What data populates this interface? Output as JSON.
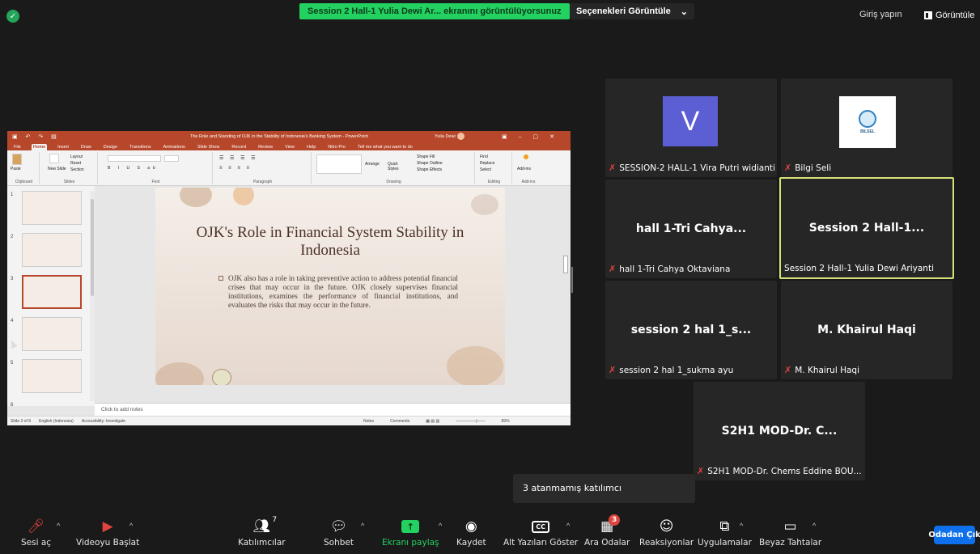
{
  "top": {
    "share_banner": "Session 2 Hall-1 Yulia Dewi Ar... ekranını görüntülüyorsunuz",
    "view_options": "Seçenekleri Görüntüle",
    "view_options_caret": "⌄",
    "signin": "Giriş yapın",
    "view_label": "Görüntüle"
  },
  "ppt": {
    "window_title": "The Role and Standing of OJK in the Stability of Indonesia's Banking System - PowerPoint",
    "user": "Yulia Dewi",
    "menu": [
      "File",
      "Home",
      "Insert",
      "Draw",
      "Design",
      "Transitions",
      "Animations",
      "Slide Show",
      "Record",
      "Review",
      "View",
      "Help",
      "Nitro Pro"
    ],
    "tell_me": "Tell me what you want to do",
    "ribbon": {
      "clipboard": "Clipboard",
      "slides": "Slides",
      "font": "Font",
      "paragraph": "Paragraph",
      "drawing": "Drawing",
      "editing": "Editing",
      "addins": "Add-ins",
      "paste": "Paste",
      "new_slide": "New Slide",
      "layout": "Layout",
      "reset": "Reset",
      "section": "Section",
      "arrange": "Arrange",
      "quick_styles": "Quick Styles",
      "shape_fill": "Shape Fill",
      "shape_outline": "Shape Outline",
      "shape_effects": "Shape Effects",
      "find": "Find",
      "replace": "Replace",
      "select": "Select",
      "add_ins_btn": "Add-ins"
    },
    "thumbs": [
      "1",
      "2",
      "3",
      "4",
      "5",
      "6"
    ],
    "selected_slide": 3,
    "slide": {
      "title": "OJK's Role in Financial System Stability in Indonesia",
      "body": "OJK also has a role in taking preventive action to address potential financial crises that may occur in the future. OJK closely supervises financial institutions, examines the performance of financial institutions, and evaluates the risks that may occur in the future."
    },
    "notes_placeholder": "Click to add notes",
    "status": {
      "slide_count": "Slide 3 of 8",
      "language": "English (Indonesia)",
      "accessibility": "Accessibility: Investigate",
      "notes": "Notes",
      "comments": "Comments",
      "zoom": "89%"
    }
  },
  "tiles": [
    {
      "caption": "SESSION-2 HALL-1 Vira Putri widianti",
      "big": "",
      "avatar": "V",
      "muted": true
    },
    {
      "caption": "Bilgi Seli",
      "big": "",
      "logo": "BILSEL",
      "muted": true
    },
    {
      "caption": "hall 1-Tri Cahya Oktaviana",
      "big": "hall 1-Tri Cahya...",
      "muted": true
    },
    {
      "caption": "Session 2 Hall-1 Yulia Dewi Ariyanti",
      "big": "Session 2 Hall-1...",
      "muted": false,
      "active": true
    },
    {
      "caption": "session 2 hal 1_sukma ayu",
      "big": "session 2 hal 1_s...",
      "muted": true
    },
    {
      "caption": "M. Khairul Haqi",
      "big": "M. Khairul Haqi",
      "muted": true
    },
    {
      "caption": "S2H1 MOD-Dr. Chems Eddine BOU...",
      "big": "S2H1 MOD-Dr. C...",
      "muted": true
    }
  ],
  "tooltip": "3 atanmamış katılımcı",
  "toolbar": {
    "mute": "Sesi aç",
    "video": "Videoyu Başlat",
    "participants": "Katılımcılar",
    "participants_count": "7",
    "chat": "Sohbet",
    "share": "Ekranı paylaş",
    "record": "Kaydet",
    "captions": "Alt Yazıları Göster",
    "cc": "CC",
    "breakout": "Ara Odalar",
    "breakout_badge": "3",
    "reactions": "Reaksiyonlar",
    "apps": "Uygulamalar",
    "whiteboard": "Beyaz Tahtalar",
    "leave": "Odadan Çık"
  },
  "colors": {
    "share_green": "#23d160",
    "ppt_red": "#b7472a",
    "leave_blue": "#0e71eb",
    "active_border": "#d8e27a",
    "mic_off_red": "#e0443e"
  }
}
